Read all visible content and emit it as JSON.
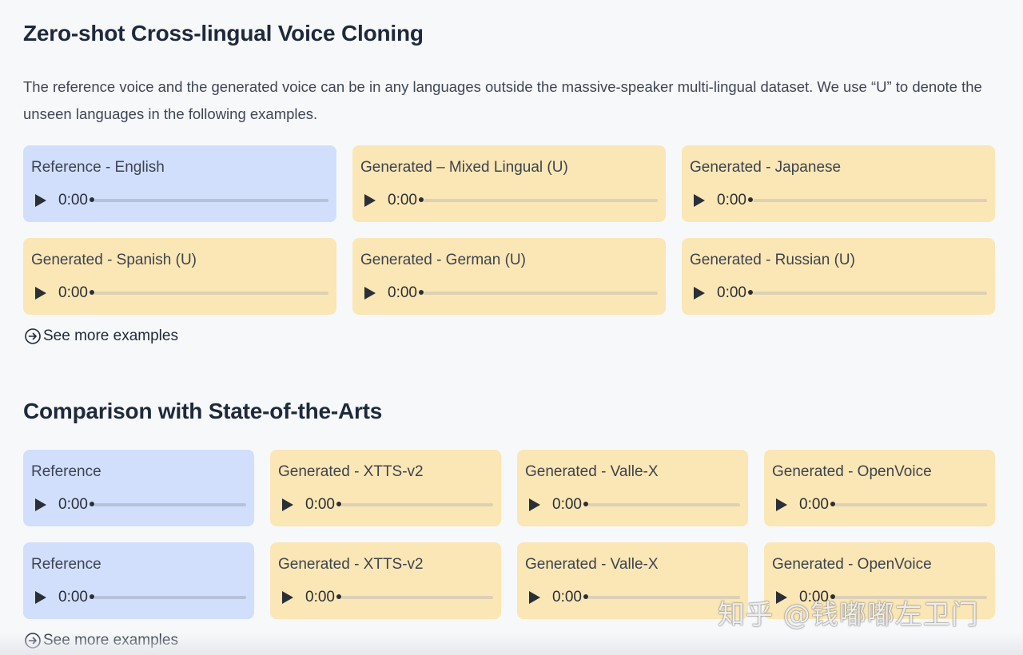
{
  "section1": {
    "title": "Zero-shot Cross-lingual Voice Cloning",
    "description": "The reference voice and the generated voice can be in any languages outside the massive-speaker multi-lingual dataset. We use “U” to denote the unseen languages in the following examples.",
    "cards": [
      {
        "label": "Reference - English",
        "kind": "reference",
        "time": "0:00"
      },
      {
        "label": "Generated – Mixed Lingual (U)",
        "kind": "generated",
        "time": "0:00"
      },
      {
        "label": "Generated - Japanese",
        "kind": "generated",
        "time": "0:00"
      },
      {
        "label": "Generated - Spanish (U)",
        "kind": "generated",
        "time": "0:00"
      },
      {
        "label": "Generated - German (U)",
        "kind": "generated",
        "time": "0:00"
      },
      {
        "label": "Generated - Russian (U)",
        "kind": "generated",
        "time": "0:00"
      }
    ],
    "see_more": "See more examples"
  },
  "section2": {
    "title": "Comparison with State-of-the-Arts",
    "cards": [
      {
        "label": "Reference",
        "kind": "reference",
        "time": "0:00"
      },
      {
        "label": "Generated - XTTS-v2",
        "kind": "generated",
        "time": "0:00"
      },
      {
        "label": "Generated - Valle-X",
        "kind": "generated",
        "time": "0:00"
      },
      {
        "label": "Generated - OpenVoice",
        "kind": "generated",
        "time": "0:00"
      },
      {
        "label": "Reference",
        "kind": "reference",
        "time": "0:00"
      },
      {
        "label": "Generated - XTTS-v2",
        "kind": "generated",
        "time": "0:00"
      },
      {
        "label": "Generated - Valle-X",
        "kind": "generated",
        "time": "0:00"
      },
      {
        "label": "Generated - OpenVoice",
        "kind": "generated",
        "time": "0:00"
      }
    ],
    "see_more": "See more examples"
  },
  "watermark": "知乎 @钱嘟嘟左卫门",
  "colors": {
    "reference_card": "#d1dffd",
    "generated_card": "#fbe7b5",
    "title_text": "#1e293b"
  },
  "icons": {
    "play": "play-icon",
    "see_more": "circle-arrow-right-icon"
  }
}
